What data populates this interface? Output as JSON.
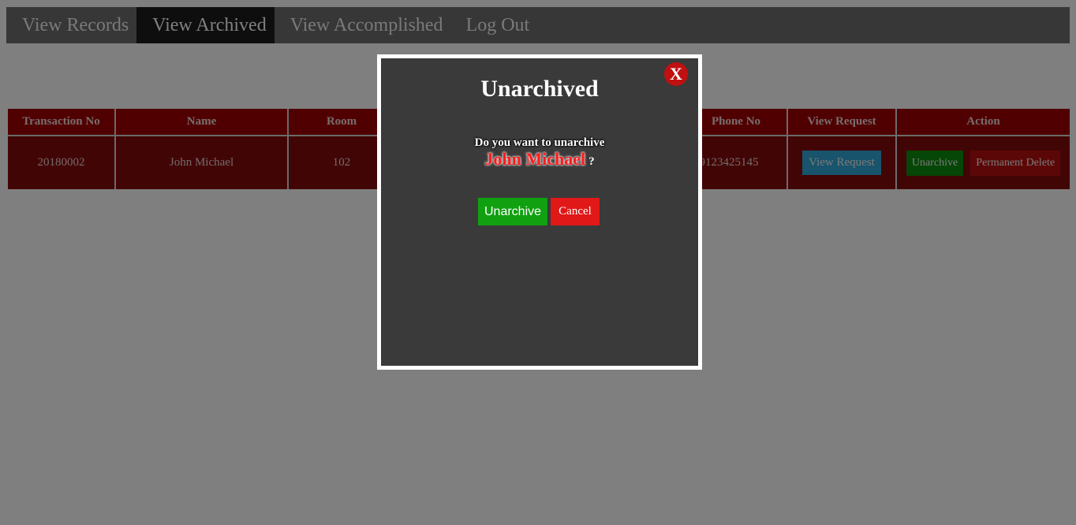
{
  "nav": {
    "items": [
      {
        "label": "View Records"
      },
      {
        "label": "View Archived"
      },
      {
        "label": "View Accomplished"
      },
      {
        "label": "Log Out"
      }
    ]
  },
  "table": {
    "headers": [
      "Transaction No",
      "Name",
      "Room",
      "",
      "Phone No",
      "View Request",
      "Action"
    ],
    "rows": [
      {
        "transaction_no": "20180002",
        "name": "John Michael",
        "room": "102",
        "hidden": "",
        "phone_no": "09123425145",
        "view_request_label": "View Request",
        "unarchive_label": "Unarchive",
        "delete_label": "Permanent Delete"
      }
    ]
  },
  "modal": {
    "close_label": "X",
    "title": "Unarchived",
    "question": "Do you want to unarchive",
    "target_name": "John Michael",
    "question_mark": "?",
    "confirm_label": "Unarchive",
    "cancel_label": "Cancel"
  },
  "colors": {
    "header_red": "#a00000",
    "row_red": "#850a0a",
    "confirm_green": "#10a010",
    "cancel_red": "#e01818",
    "view_blue": "#31a8d8"
  }
}
